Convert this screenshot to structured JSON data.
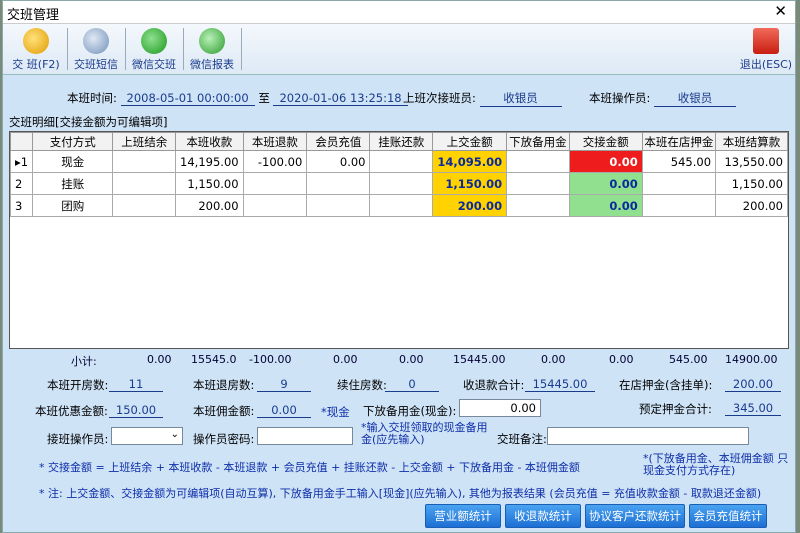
{
  "window": {
    "title": "交班管理",
    "close_glyph": "✕"
  },
  "toolbar": {
    "items": [
      {
        "label": "交 班(F2)",
        "icon": "key-people-icon",
        "color": "#f5b50a"
      },
      {
        "label": "交班短信",
        "icon": "sms-icon",
        "color": "#7a9cc0"
      },
      {
        "label": "微信交班",
        "icon": "wechat-check-icon",
        "color": "#2aa82a"
      },
      {
        "label": "微信报表",
        "icon": "wechat-report-icon",
        "color": "#3aa53a"
      }
    ],
    "exit_label": "退出(ESC)"
  },
  "shift": {
    "time_label": "本班时间:",
    "start": "2008-05-01 00:00:00",
    "to": "至",
    "end": "2020-01-06 13:25:18",
    "next_label": "上班次接班员:",
    "next_value": "收银员",
    "operator_label": "本班操作员:",
    "operator_value": "收银员"
  },
  "detail_title": "交班明细[交接金额为可编辑项]",
  "table": {
    "headers": [
      "",
      "支付方式",
      "上班结余",
      "本班收款",
      "本班退款",
      "会员充值",
      "挂账还款",
      "上交金额",
      "下放备用金",
      "交接金额",
      "本班在店押金",
      "本班结算款"
    ],
    "rows": [
      {
        "no": "▸1",
        "method": "现金",
        "prev": "",
        "recv": "14,195.00",
        "refund": "-100.00",
        "member": "0.00",
        "credit": "",
        "handin": "14,095.00",
        "reserve": "",
        "handover": "0.00",
        "deposit": "545.00",
        "settle": "13,550.00"
      },
      {
        "no": "2",
        "method": "挂账",
        "prev": "",
        "recv": "1,150.00",
        "refund": "",
        "member": "",
        "credit": "",
        "handin": "1,150.00",
        "reserve": "",
        "handover": "0.00",
        "deposit": "",
        "settle": "1,150.00"
      },
      {
        "no": "3",
        "method": "团购",
        "prev": "",
        "recv": "200.00",
        "refund": "",
        "member": "",
        "credit": "",
        "handin": "200.00",
        "reserve": "",
        "handover": "0.00",
        "deposit": "",
        "settle": "200.00"
      }
    ]
  },
  "subtotal": {
    "label": "小计:",
    "prev": "0.00",
    "recv": "15545.0",
    "refund": "-100.00",
    "member": "0.00",
    "credit": "0.00",
    "handin": "15445.00",
    "reserve": "0.00",
    "handover": "0.00",
    "deposit": "545.00",
    "settle": "14900.00"
  },
  "stats": {
    "open_rooms_label": "本班开房数:",
    "open_rooms": "11",
    "checkout_rooms_label": "本班退房数:",
    "checkout_rooms": "9",
    "continue_rooms_label": "续住房数:",
    "continue_rooms": "0",
    "refund_total_label": "收退款合计:",
    "refund_total": "15445.00",
    "deposit_label": "在店押金(含挂单):",
    "deposit": "200.00",
    "discount_label": "本班优惠金额:",
    "discount": "150.00",
    "commission_label": "本班佣金额:",
    "commission": "0.00",
    "cash_tag": "*现金",
    "reserve_label": "下放备用金(现金):",
    "reserve_value": "0.00",
    "booking_label": "预定押金合计:",
    "booking": "345.00"
  },
  "form": {
    "handover_op_label": "接班操作员:",
    "password_label": "操作员密码:",
    "reserve_hint": "*输入交班领取的现金备用金(应先输入)",
    "remark_label": "交班备注:"
  },
  "notes": {
    "formula": "* 交接金额 = 上班结余 + 本班收款 - 本班退款 + 会员充值 + 挂账还款 - 上交金额 + 下放备用金 - 本班佣金额",
    "side": "*(下放备用金、本班佣金额 只现金支付方式存在)",
    "note2": "* 注: 上交金额、交接金额为可编辑项(自动互算), 下放备用金手工输入[现金](应先输入), 其他为报表结果 (会员充值 = 充值收款金额 - 取款退还金额)"
  },
  "buttons": [
    "营业额统计",
    "收退款统计",
    "协议客户还款统计",
    "会员充值统计"
  ]
}
